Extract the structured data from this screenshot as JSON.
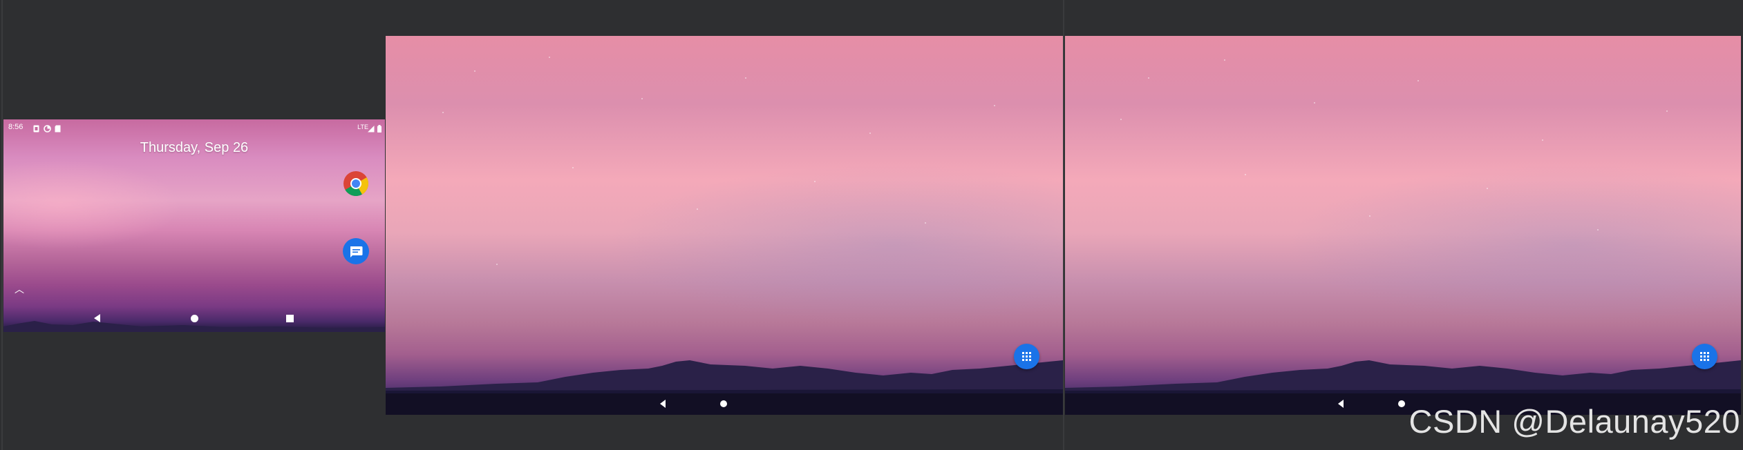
{
  "phone": {
    "status_time": "8:56",
    "status_network": "LTE",
    "date_text": "Thursday, Sep 26",
    "apps": [
      {
        "icon": "chrome-icon"
      },
      {
        "icon": "messages-icon"
      }
    ],
    "nav": [
      "back-icon",
      "home-icon",
      "recents-icon"
    ]
  },
  "tablet_screens": [
    {
      "fab_icon": "app-drawer-grid-icon",
      "nav": [
        "back-icon",
        "home-icon"
      ]
    },
    {
      "fab_icon": "app-drawer-grid-icon",
      "nav": [
        "back-icon",
        "home-icon"
      ]
    }
  ],
  "watermark": "CSDN @Delaunay520",
  "colors": {
    "canvas_bg": "#2e2f31",
    "fab_blue": "#1a73e8",
    "navbar": "#120f24",
    "sky_pink": "#f4a9b9"
  }
}
